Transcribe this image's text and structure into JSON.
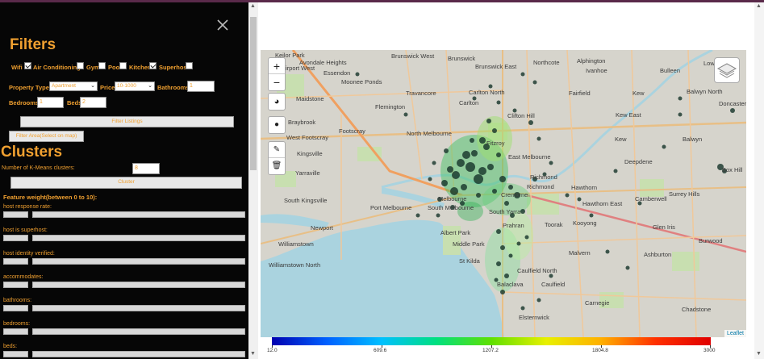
{
  "panel": {
    "filters_title": "Filters",
    "amenities": [
      {
        "label": "Wifi",
        "checked": true
      },
      {
        "label": "Air Conditioning",
        "checked": false
      },
      {
        "label": "Gym",
        "checked": false
      },
      {
        "label": "Pool",
        "checked": false
      },
      {
        "label": "Kitchen",
        "checked": true
      },
      {
        "label": "Superhost",
        "checked": false
      }
    ],
    "property_type_label": "Property Type",
    "property_type_value": "Apartment",
    "price_label": "Price",
    "price_value": "10-1000",
    "bathrooms_label": "Bathrooms:",
    "bathrooms_value": "1",
    "bedrooms_label": "Bedrooms:",
    "bedrooms_value": "1",
    "beds_label": "Beds:",
    "beds_value": "2",
    "filter_listings_button": "Filter Listings",
    "filter_area_button": "Filter Area(Select on map)",
    "clusters_title": "Clusters",
    "kmeans_label": "Number of K-Means clusters:",
    "kmeans_value": "8",
    "cluster_button": "Cluster",
    "feature_weight_title": "Feature weight(between 0 to 10):",
    "features": [
      "host response rate:",
      "host is superhost:",
      "host identity verified:",
      "accommodates:",
      "bathrooms:",
      "bedrooms:",
      "beds:"
    ]
  },
  "map": {
    "labels": [
      "Keilor Park",
      "Avondale Heights",
      "Brunswick West",
      "Brunswick",
      "Brunswick East",
      "Northcote",
      "Alphington",
      "Ivanhoe",
      "Bulleen",
      "Lower Plenty",
      "Doncaster",
      "Airport West",
      "Essendon",
      "Moonee Ponds",
      "Travancore",
      "Carlton North",
      "Fairfield",
      "Kew",
      "Balwyn North",
      "Maidstone",
      "Flemington",
      "Carlton",
      "Clifton Hill",
      "Kew East",
      "Braybrook",
      "West Footscray",
      "Footscray",
      "North Melbourne",
      "Fitzroy",
      "Kew",
      "Balwyn",
      "Kingsville",
      "Deepdene",
      "Yarraville",
      "Box Hill",
      "Richmond",
      "Hawthorn",
      "Camberwell",
      "South Kingsville",
      "Port Melbourne",
      "South Melbourne",
      "Cremorne",
      "Hawthorn East",
      "Surrey Hills",
      "Newport",
      "Toorak",
      "Kooyong",
      "Albert Park",
      "Middle Park",
      "St Kilda",
      "Williamstown",
      "Burwood",
      "Ashburton",
      "Williamstown North",
      "Malvern",
      "Caulfield North",
      "Balaclava",
      "Caulfield",
      "Carnegie",
      "Elsternwick",
      "Chadstone",
      "Glen Iris",
      "South Yarra",
      "Prahran",
      "East Melbourne",
      "Melbourne",
      "Richmond"
    ],
    "attribution": "Leaflet",
    "controls": {
      "zoom_in": "+",
      "zoom_out": "−"
    }
  },
  "scale": {
    "ticks": [
      "12.0",
      "609.6",
      "1207.2",
      "1804.8",
      "3000"
    ],
    "colors": [
      "#0000b0",
      "#0060ff",
      "#00c0ff",
      "#00e080",
      "#60e000",
      "#e8f000",
      "#ffb000",
      "#ff3000",
      "#e00000"
    ]
  }
}
